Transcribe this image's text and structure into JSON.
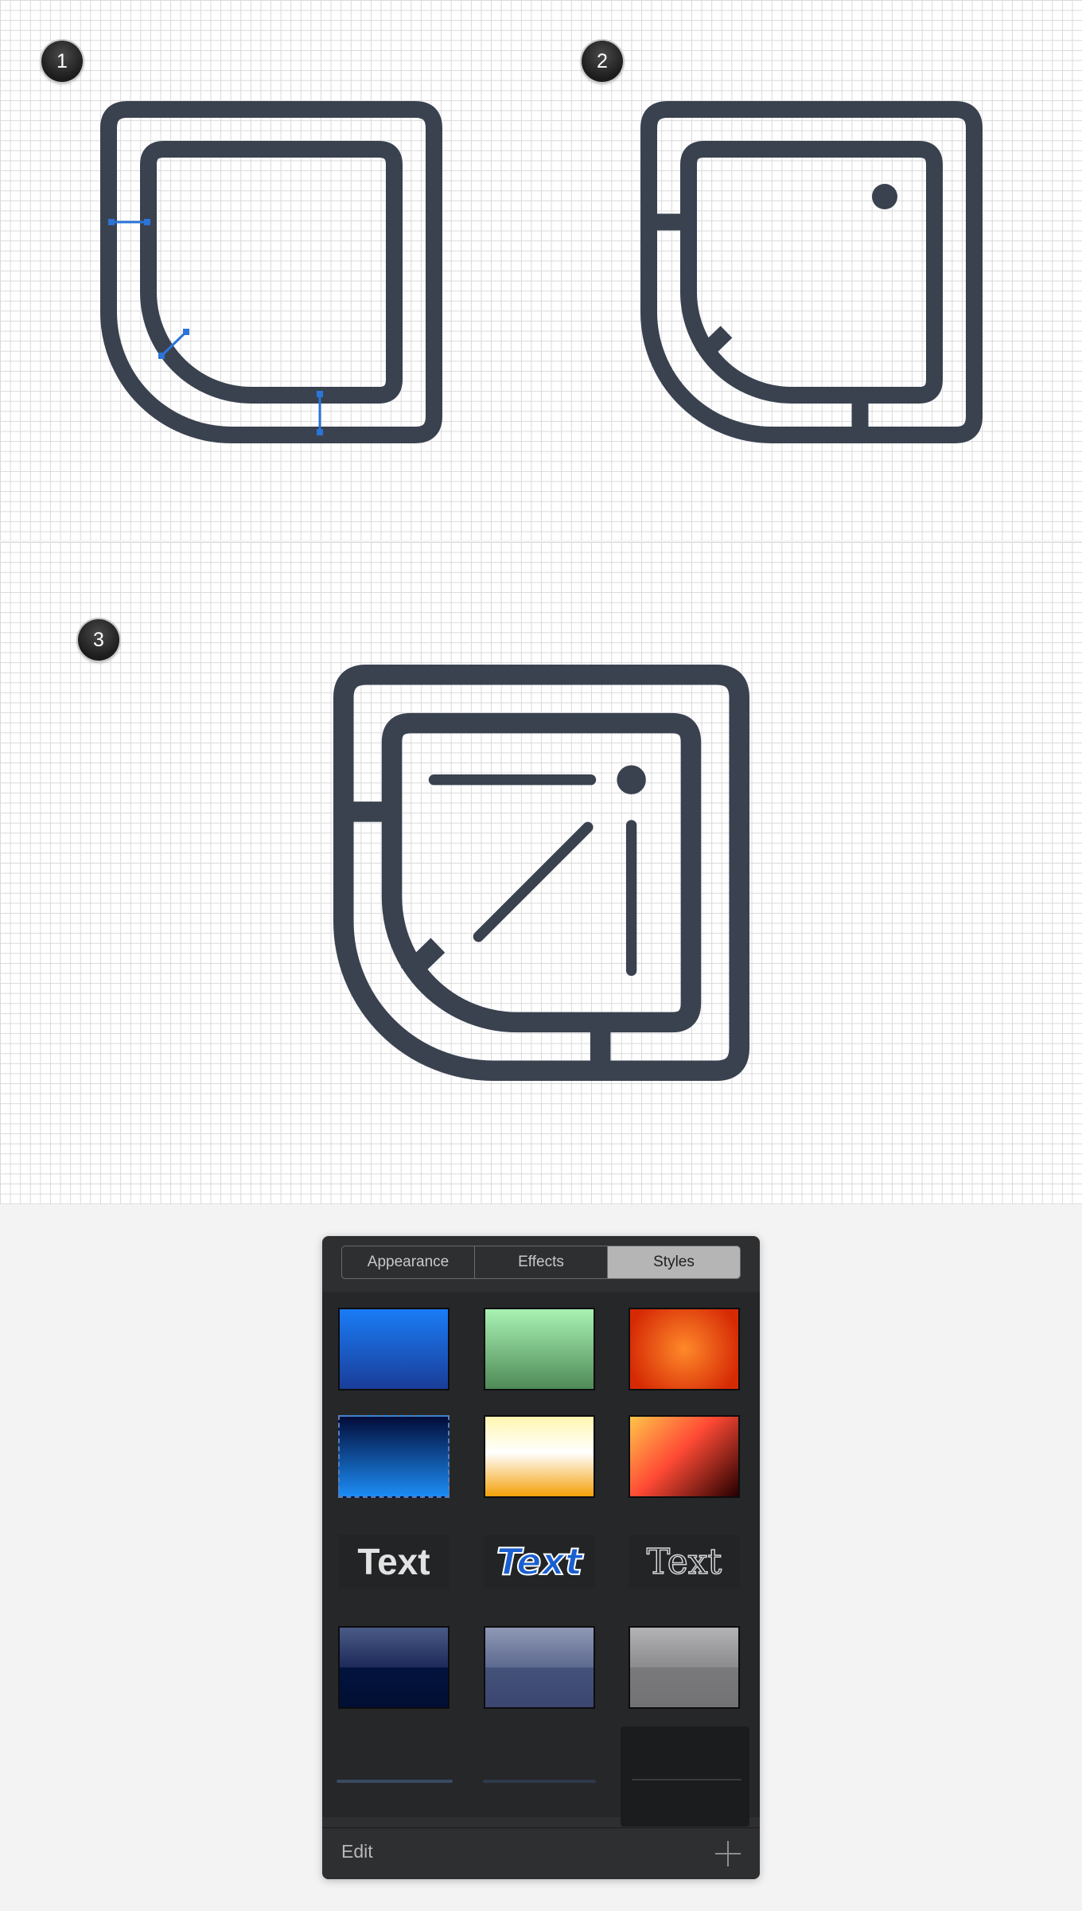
{
  "steps": [
    {
      "number": "1"
    },
    {
      "number": "2"
    },
    {
      "number": "3"
    }
  ],
  "colors": {
    "icon_stroke": "#3a4250",
    "guide_accent": "#2b74d8",
    "grid_line": "#d9d9d9"
  },
  "illustration": {
    "subject": "shower-tray-icon",
    "guides_shown_in_step": "1"
  },
  "styles_panel": {
    "tabs": [
      {
        "label": "Appearance",
        "active": false
      },
      {
        "label": "Effects",
        "active": false
      },
      {
        "label": "Styles",
        "active": true
      }
    ],
    "swatches": [
      {
        "name": "blue-gradient",
        "type": "fill"
      },
      {
        "name": "green-gradient",
        "type": "fill"
      },
      {
        "name": "orange-radial",
        "type": "fill"
      },
      {
        "name": "navy-blue-dashed",
        "type": "fill"
      },
      {
        "name": "cream-yellow-gradient",
        "type": "fill"
      },
      {
        "name": "orange-red-dark-gradient",
        "type": "fill"
      },
      {
        "name": "bold-text",
        "type": "text",
        "text": "Text"
      },
      {
        "name": "blue-outlined-text",
        "type": "text",
        "text": "Text"
      },
      {
        "name": "slab-serif-text",
        "type": "text",
        "text": "Text"
      },
      {
        "name": "navy-glossy",
        "type": "fill"
      },
      {
        "name": "slate-glossy",
        "type": "fill"
      },
      {
        "name": "gray-glossy",
        "type": "fill"
      },
      {
        "name": "stroke-dark-blue",
        "type": "stroke"
      },
      {
        "name": "stroke-dark-slate",
        "type": "stroke"
      },
      {
        "name": "stroke-dark-selected",
        "type": "stroke",
        "selected": true
      }
    ],
    "footer": {
      "edit_label": "Edit",
      "add_icon": "plus-icon"
    }
  }
}
